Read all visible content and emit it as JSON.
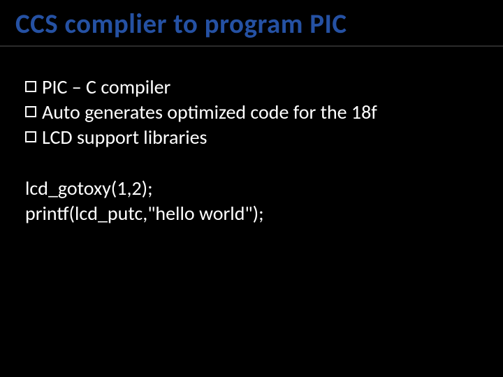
{
  "title": "CCS complier to program PIC",
  "bullets": [
    "PIC – C compiler",
    "Auto generates optimized code for the 18f",
    "LCD support libraries"
  ],
  "code_lines": [
    "lcd_gotoxy(1,2);",
    "printf(lcd_putc,\"hello world\");"
  ]
}
